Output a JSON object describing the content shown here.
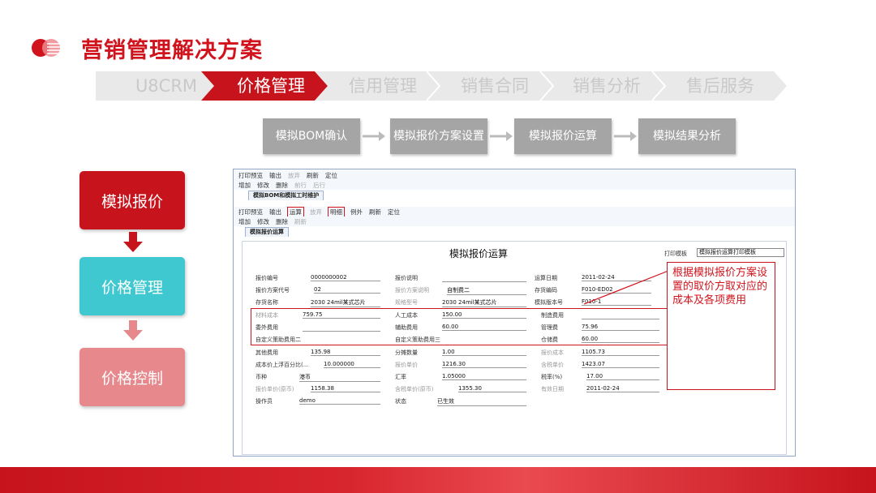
{
  "page": {
    "title": "营销管理解决方案"
  },
  "breadcrumb": [
    "U8CRM",
    "价格管理",
    "信用管理",
    "销售合同",
    "销售分析",
    "售后服务"
  ],
  "flow": [
    "模拟BOM确认",
    "模拟报价方案设置",
    "模拟报价运算",
    "模拟结果分析"
  ],
  "steps": [
    "模拟报价",
    "价格管理",
    "价格控制"
  ],
  "colors": {
    "accent": "#c7141c",
    "teal": "#3fc8cf",
    "pink": "#e6888c",
    "gray_box": "#a5a5a5"
  },
  "app": {
    "toolbar1": [
      "打印预览",
      "输出",
      "放弃",
      "刷新",
      "定位"
    ],
    "toolbar2": [
      "增加",
      "修改",
      "删除",
      "前行",
      "后行"
    ],
    "outer_tab": "模拟BOM和模拟工时维护",
    "toolbar3": [
      "打印预览",
      "输出",
      "运算",
      "放弃",
      "明细",
      "例外",
      "刷新",
      "定位"
    ],
    "toolbar4": [
      "增加",
      "修改",
      "删除",
      "刷新"
    ],
    "inner_tab": "模拟报价运算",
    "form_title": "模拟报价运算",
    "print_template_label": "打印模板",
    "print_template_value": "模拟报价运算打印模板",
    "fields": [
      {
        "label": "报价编号",
        "value": "0000000002"
      },
      {
        "label": "报价说明",
        "value": ""
      },
      {
        "label": "运算日期",
        "value": "2011-02-24"
      },
      {
        "label": "报价方案代号",
        "value": "02"
      },
      {
        "label": "报价方案说明",
        "value": "自制费二"
      },
      {
        "label": "存货编码",
        "value": "F010-ED02"
      },
      {
        "label": "存货名称",
        "value": "2030 24mil某式芯片"
      },
      {
        "label": "规格型号",
        "value": "2030 24mil某式芯片"
      },
      {
        "label": "模拟版本号",
        "value": "F010-1"
      },
      {
        "label": "材料成本",
        "value": "759.75"
      },
      {
        "label": "人工成本",
        "value": "150.00"
      },
      {
        "label": "制造费用",
        "value": ""
      },
      {
        "label": "委外费用",
        "value": ""
      },
      {
        "label": "辅助费用",
        "value": "60.00"
      },
      {
        "label": "管理费",
        "value": "75.96"
      },
      {
        "label": "自定义策助费用二",
        "value": ""
      },
      {
        "label": "自定义策助费用三",
        "value": ""
      },
      {
        "label": "仓储费",
        "value": "60.00"
      },
      {
        "label": "其他费用",
        "value": "135.98"
      },
      {
        "label": "分摊数量",
        "value": "1.00"
      },
      {
        "label": "报价成本",
        "value": "1105.73"
      },
      {
        "label": "成本价上浮百分比(...",
        "value": "10.000000"
      },
      {
        "label": "报价单价",
        "value": "1216.30"
      },
      {
        "label": "含税单价",
        "value": "1423.07"
      },
      {
        "label": "币种",
        "value": "港币"
      },
      {
        "label": "汇率",
        "value": "1.05000"
      },
      {
        "label": "税率(%)",
        "value": "17.00"
      },
      {
        "label": "报价单价(原币)",
        "value": "1158.38"
      },
      {
        "label": "含税单价(原币)",
        "value": "1355.30"
      },
      {
        "label": "有效日期",
        "value": "2011-02-24"
      },
      {
        "label": "操作员",
        "value": "demo"
      },
      {
        "label": "状态",
        "value": "已生效"
      }
    ]
  },
  "callout": "根据模拟报价方案设置的取价方取对应的成本及各项费用"
}
